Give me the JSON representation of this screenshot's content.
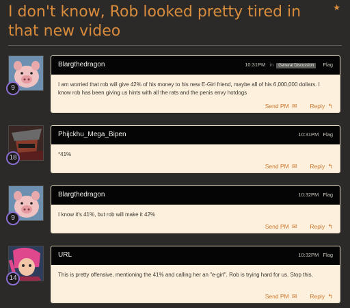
{
  "thread": {
    "title": "I don't know, Rob looked pretty tired in that new video",
    "star_icon": "★"
  },
  "actions": {
    "send_pm": "Send PM",
    "reply": "Reply",
    "flag": "Flag",
    "in_label": "in",
    "envelope_icon": "✉",
    "reply_arrow_icon": "↰"
  },
  "posts": [
    {
      "author": "Blargthedragon",
      "level": "9",
      "time": "10:31PM",
      "forum": "General Discussion",
      "text": "I am worried that rob will give 42% of his money to his new E-Girl friend, maybe all of his 6,000,000 dollars. I know rob has been giving us hints with all the rats and the penis envy hotdogs",
      "avatar": "pig-avatar"
    },
    {
      "author": "Phijckhu_Mega_Bipen",
      "level": "18",
      "time": "10:31PM",
      "text": "*41%",
      "avatar": "masked-character-avatar"
    },
    {
      "author": "Blargthedragon",
      "level": "9",
      "time": "10:32PM",
      "text": "I know it's 41%, but rob will make it 42%",
      "avatar": "pig-avatar"
    },
    {
      "author": "URL",
      "level": "14",
      "time": "10:32PM",
      "text": "This is pretty offensive, mentioning the 41% and calling her an \"e-girl\". Rob is trying hard for us. Stop this.",
      "avatar": "pink-hair-character-avatar"
    }
  ],
  "colors": {
    "background": "#2b2a28",
    "accent": "#d98c3c",
    "header": "#050505",
    "body": "#fdf0dd",
    "badge_ring": "#8a6fd1"
  }
}
